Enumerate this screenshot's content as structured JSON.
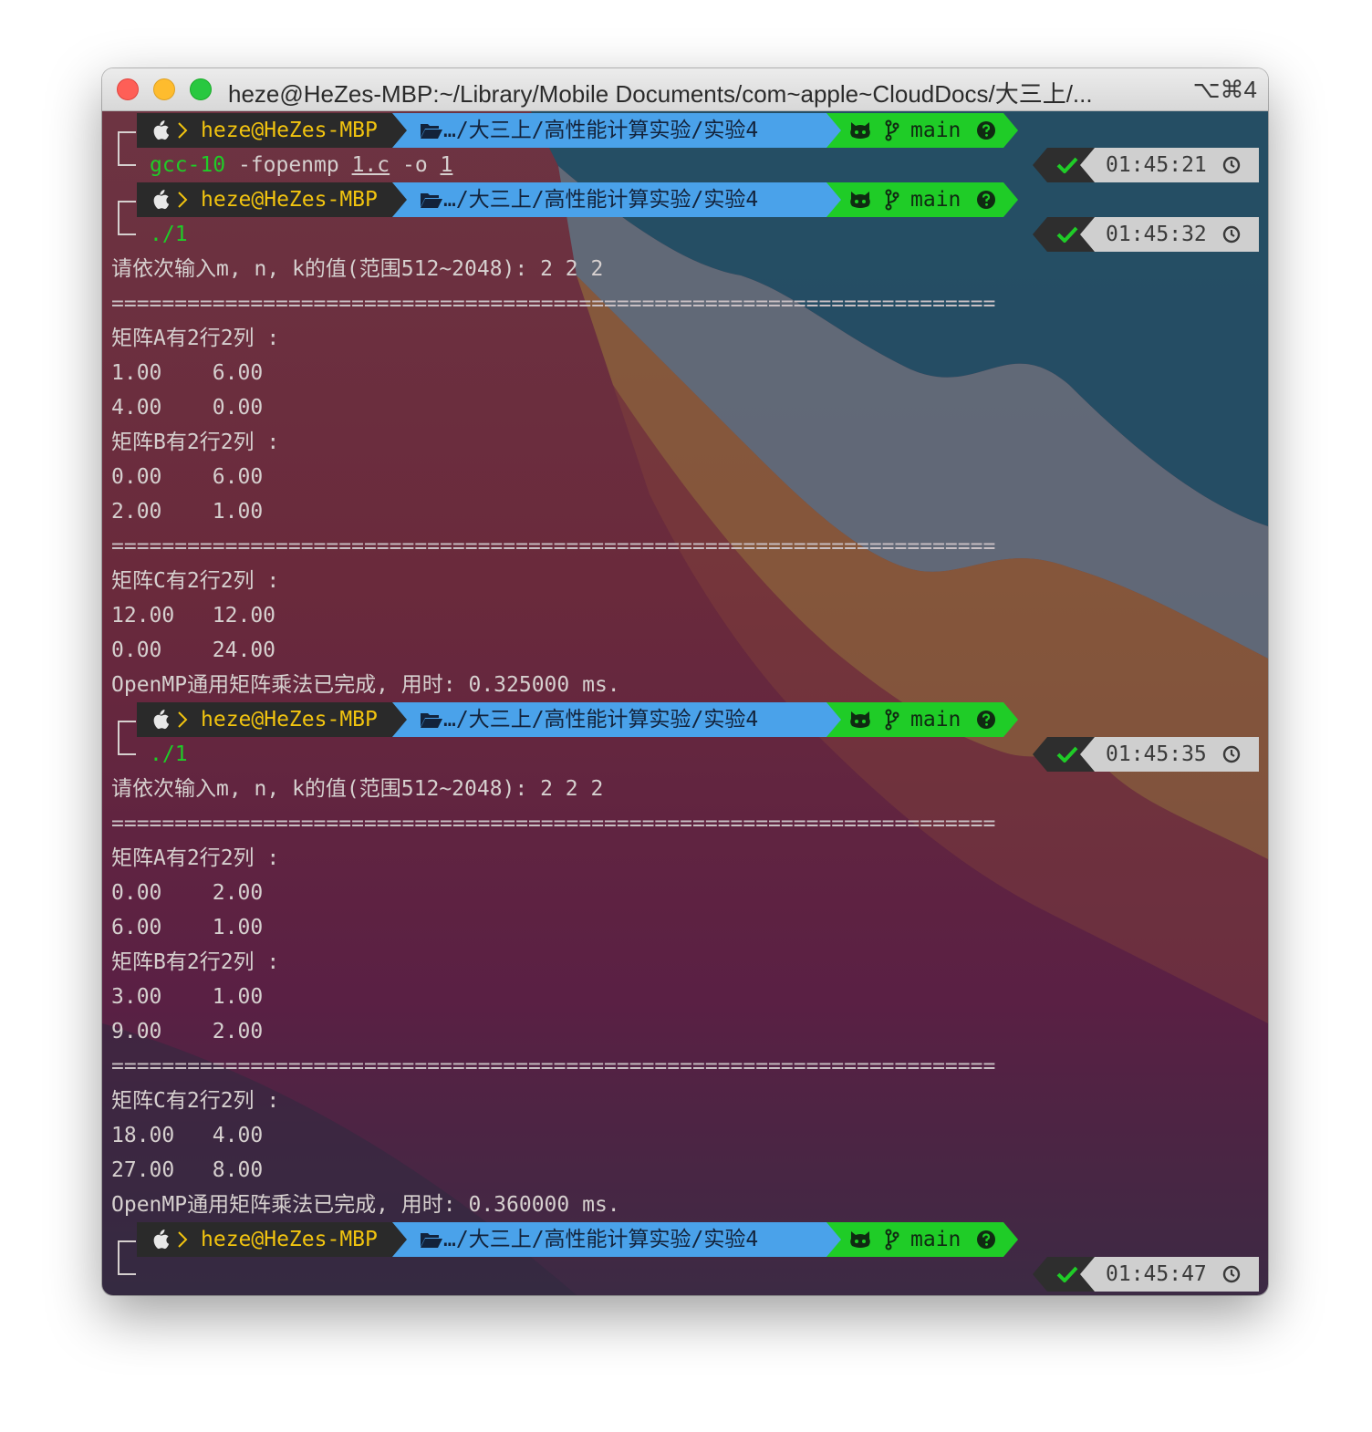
{
  "window": {
    "title": "heze@HeZes-MBP:~/Library/Mobile Documents/com~apple~CloudDocs/大三上/...",
    "shortcut": "⌥⌘4"
  },
  "prompt": {
    "user": "heze@HeZes-MBP",
    "path": "…/大三上/高性能计算实验/实验4",
    "branch": "main"
  },
  "colors": {
    "user_text": "#f2c40f",
    "path_segment": "#4aa2ea",
    "git_segment": "#1fcc27",
    "command": "#1fcc27",
    "status_ok": "#1fcc27"
  },
  "icons": [
    "apple-icon",
    "chevron-right-icon",
    "folder-open-icon",
    "github-cat-icon",
    "git-branch-icon",
    "question-circle-icon",
    "check-icon",
    "clock-icon"
  ],
  "blocks": [
    {
      "command": [
        "gcc-10",
        " -fopenmp ",
        "1.c",
        " -o ",
        "1"
      ],
      "time": "01:45:21"
    },
    {
      "command": [
        "./1"
      ],
      "time": "01:45:32",
      "output": [
        "请依次输入m, n, k的值(范围512~2048): 2 2 2",
        "======================================================================",
        "矩阵A有2行2列 :",
        "1.00    6.00",
        "4.00    0.00",
        "矩阵B有2行2列 :",
        "0.00    6.00",
        "2.00    1.00",
        "======================================================================",
        "矩阵C有2行2列 :",
        "12.00   12.00",
        "0.00    24.00",
        "OpenMP通用矩阵乘法已完成, 用时: 0.325000 ms."
      ]
    },
    {
      "command": [
        "./1"
      ],
      "time": "01:45:35",
      "output": [
        "请依次输入m, n, k的值(范围512~2048): 2 2 2",
        "======================================================================",
        "矩阵A有2行2列 :",
        "0.00    2.00",
        "6.00    1.00",
        "矩阵B有2行2列 :",
        "3.00    1.00",
        "9.00    2.00",
        "======================================================================",
        "矩阵C有2行2列 :",
        "18.00   4.00",
        "27.00   8.00",
        "OpenMP通用矩阵乘法已完成, 用时: 0.360000 ms."
      ]
    },
    {
      "command": [],
      "time": "01:45:47"
    }
  ]
}
